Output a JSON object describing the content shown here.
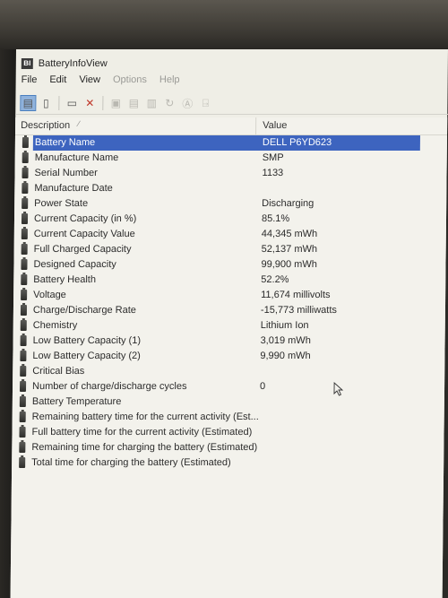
{
  "window": {
    "title": "BatteryInfoView",
    "app_icon_text": "BI"
  },
  "menu": [
    {
      "label": "File",
      "disabled": false
    },
    {
      "label": "Edit",
      "disabled": false
    },
    {
      "label": "View",
      "disabled": false
    },
    {
      "label": "Options",
      "disabled": true
    },
    {
      "label": "Help",
      "disabled": true
    }
  ],
  "toolbar": [
    {
      "name": "battery-info-mode-icon",
      "glyph": "▤",
      "active": true
    },
    {
      "name": "battery-log-mode-icon",
      "glyph": "▯",
      "active": false
    },
    {
      "sep": true
    },
    {
      "name": "properties-icon",
      "glyph": "▭",
      "active": false
    },
    {
      "name": "delete-icon",
      "glyph": "✕",
      "active": false,
      "color": "#c0392b"
    },
    {
      "sep": true
    },
    {
      "name": "save-icon",
      "glyph": "▣",
      "disabled": true
    },
    {
      "name": "copy-icon",
      "glyph": "▤",
      "disabled": true
    },
    {
      "name": "html-report-icon",
      "glyph": "▥",
      "disabled": true
    },
    {
      "name": "refresh-icon",
      "glyph": "↻",
      "disabled": true
    },
    {
      "name": "about-icon",
      "glyph": "Ⓐ",
      "disabled": true
    },
    {
      "name": "exit-icon",
      "glyph": "⍈",
      "disabled": true
    }
  ],
  "list": {
    "columns": {
      "description": "Description",
      "value": "Value"
    },
    "rows": [
      {
        "description": "Battery Name",
        "value": "DELL P6YD623",
        "selected": true
      },
      {
        "description": "Manufacture Name",
        "value": "SMP"
      },
      {
        "description": "Serial Number",
        "value": "1133"
      },
      {
        "description": "Manufacture Date",
        "value": ""
      },
      {
        "description": "Power State",
        "value": "Discharging"
      },
      {
        "description": "Current Capacity (in %)",
        "value": "85.1%"
      },
      {
        "description": "Current Capacity Value",
        "value": "44,345 mWh"
      },
      {
        "description": "Full Charged Capacity",
        "value": "52,137 mWh"
      },
      {
        "description": "Designed Capacity",
        "value": "99,900 mWh"
      },
      {
        "description": "Battery Health",
        "value": "52.2%"
      },
      {
        "description": "Voltage",
        "value": "11,674 millivolts"
      },
      {
        "description": "Charge/Discharge Rate",
        "value": "-15,773 milliwatts"
      },
      {
        "description": "Chemistry",
        "value": "Lithium Ion"
      },
      {
        "description": "Low Battery Capacity (1)",
        "value": "3,019 mWh"
      },
      {
        "description": "Low Battery Capacity (2)",
        "value": "9,990 mWh"
      },
      {
        "description": "Critical Bias",
        "value": ""
      },
      {
        "description": "Number of charge/discharge cycles",
        "value": "0"
      },
      {
        "description": "Battery Temperature",
        "value": ""
      },
      {
        "description": "Remaining battery time for the current activity (Est...",
        "value": ""
      },
      {
        "description": "Full battery time for the current activity (Estimated)",
        "value": ""
      },
      {
        "description": "Remaining time for charging the battery (Estimated)",
        "value": ""
      },
      {
        "description": "Total  time for charging the battery (Estimated)",
        "value": ""
      }
    ]
  }
}
